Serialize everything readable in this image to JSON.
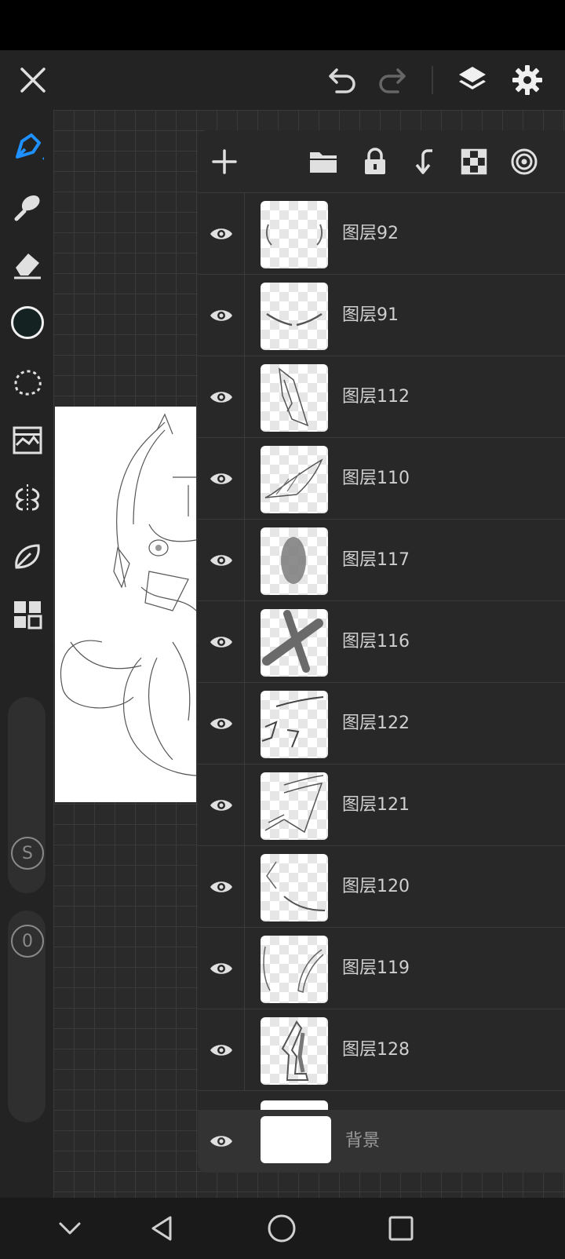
{
  "top_bar": {
    "close_icon": "close-icon",
    "undo_icon": "undo-icon",
    "redo_icon": "redo-icon",
    "layers_icon": "layers-icon",
    "settings_icon": "gear-icon"
  },
  "toolbar": {
    "tools": [
      "brush",
      "smudge",
      "eraser",
      "color",
      "lasso",
      "image",
      "symmetry",
      "ruler",
      "more"
    ],
    "color_value": "#142322",
    "size_label": "S",
    "opacity_label": "0"
  },
  "layers_panel": {
    "layers": [
      {
        "name": "图层92"
      },
      {
        "name": "图层91"
      },
      {
        "name": "图层112"
      },
      {
        "name": "图层110"
      },
      {
        "name": "图层117"
      },
      {
        "name": "图层116"
      },
      {
        "name": "图层122"
      },
      {
        "name": "图层121"
      },
      {
        "name": "图层120"
      },
      {
        "name": "图层119"
      },
      {
        "name": "图层128"
      }
    ],
    "background_layer": {
      "name": "背景"
    }
  },
  "colors": {
    "accent": "#1e90ff",
    "panel": "#282828",
    "text": "#cfcfcf"
  }
}
